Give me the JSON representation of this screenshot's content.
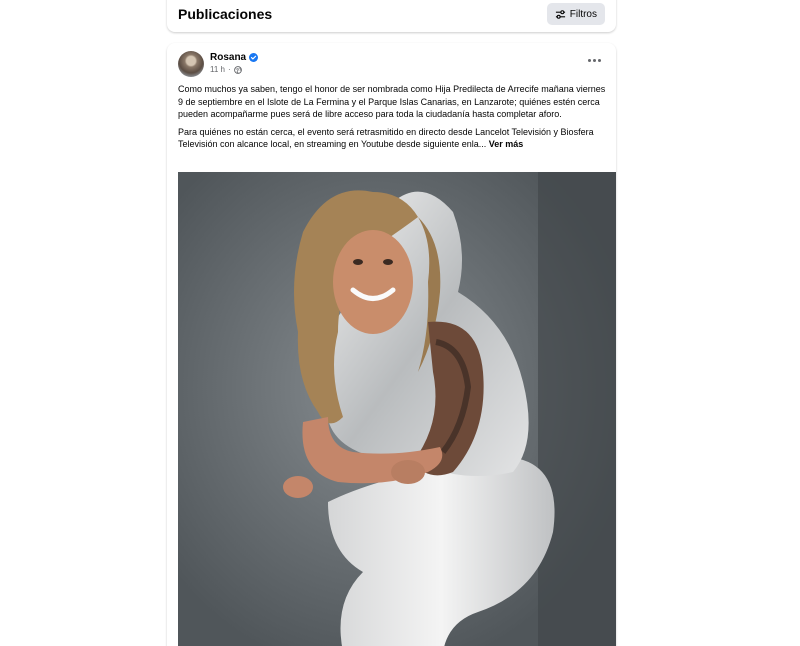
{
  "header": {
    "title": "Publicaciones",
    "filter_label": "Filtros"
  },
  "post": {
    "author": "Rosana",
    "time": "11 h",
    "separator": "·",
    "paragraph1": "Como muchos ya saben,  tengo el honor de ser nombrada como Hija Predilecta de Arrecife mañana viernes 9 de septiembre en el Islote de La Fermina y el Parque Islas Canarias, en Lanzarote; quiénes estén cerca pueden acompañarme pues será de libre acceso para toda la ciudadanía hasta completar aforo.",
    "paragraph2": "Para quiénes no están cerca, el evento será retrasmitido en directo desde Lancelot Televisión y Biosfera Televisión con alcance local, en streaming en Youtube desde siguiente enla...",
    "see_more": "Ver más"
  },
  "icons": {
    "filter": "sliders-icon",
    "verified": "verified-badge-icon",
    "audience": "globe-icon",
    "more": "more-horizontal-icon"
  },
  "colors": {
    "verified": "#1877f2",
    "secondary_text": "#65676b",
    "button_bg": "#e4e6eb"
  }
}
